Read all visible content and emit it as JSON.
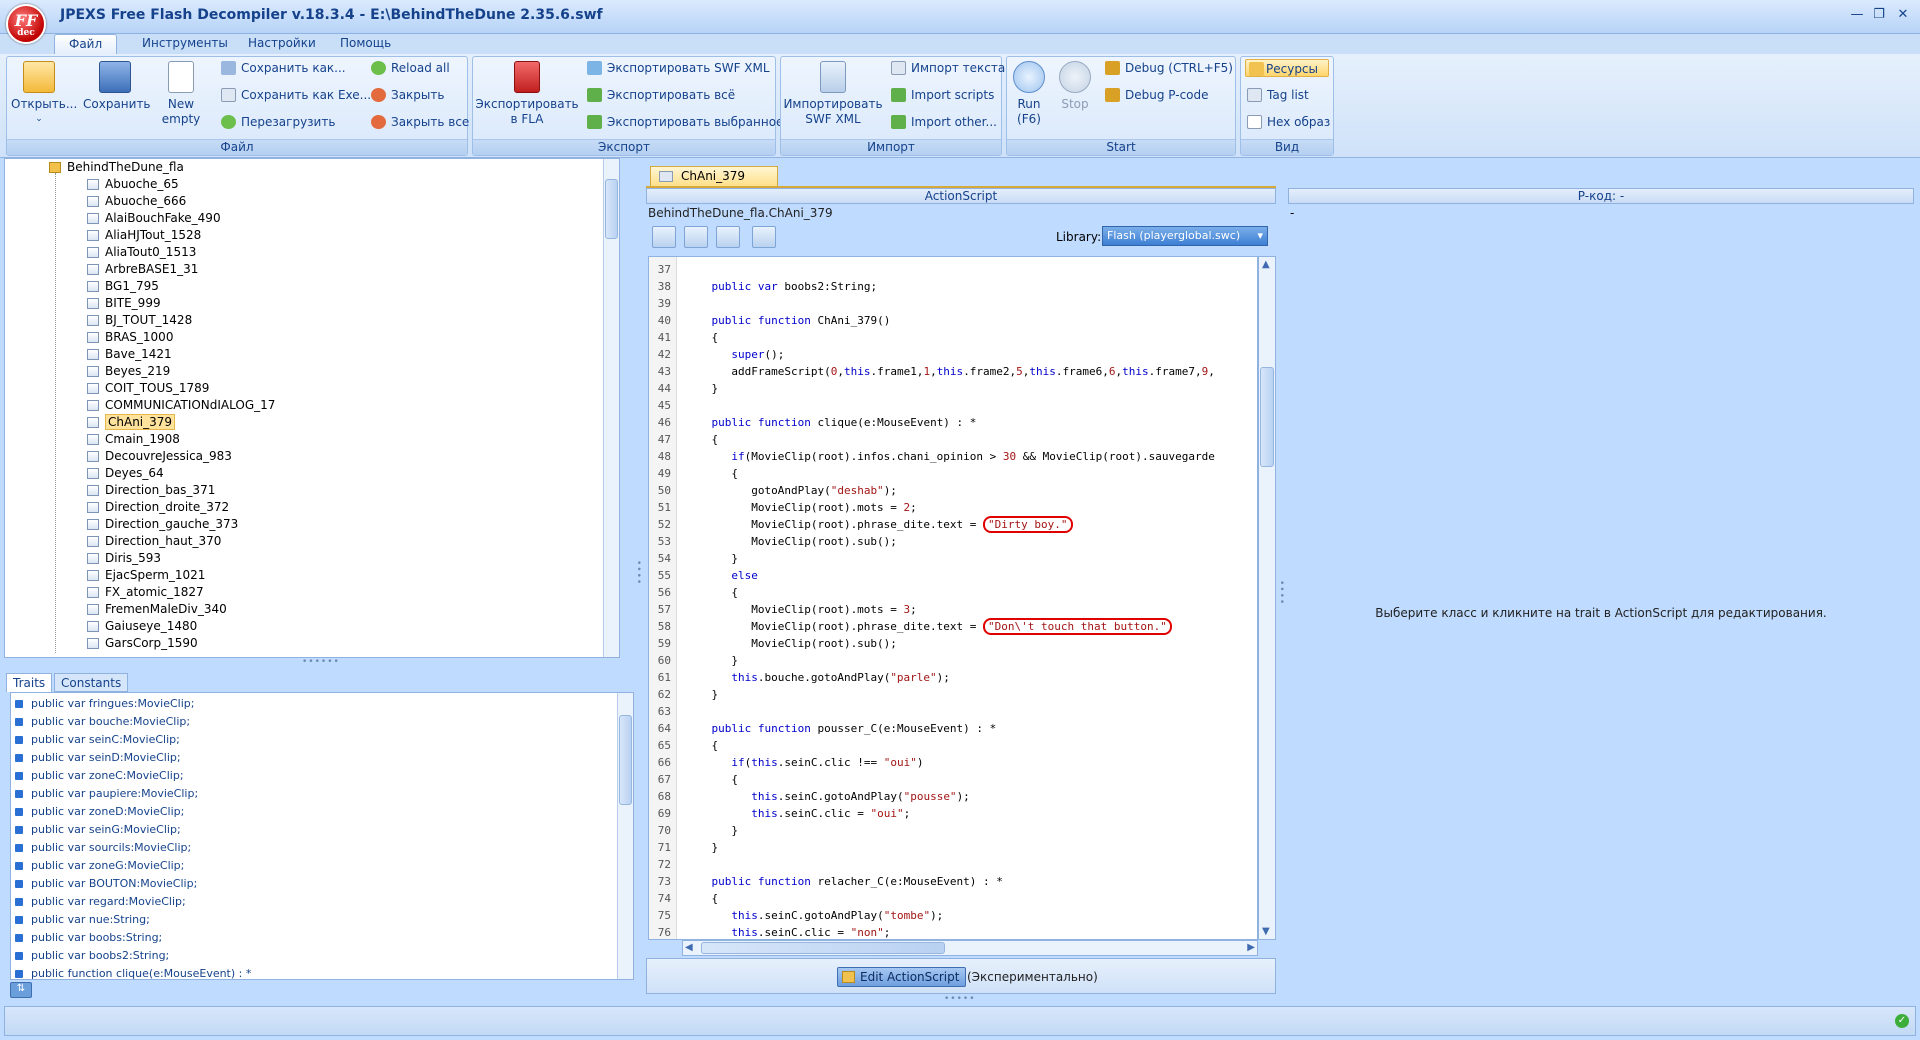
{
  "app": {
    "title": "JPEXS Free Flash Decompiler v.18.3.4 - E:\\BehindTheDune 2.35.6.swf",
    "logo_text": "FF",
    "logo_sub": "dec"
  },
  "menu_tabs": [
    "Файл",
    "Инструменты",
    "Настройки",
    "Помощь"
  ],
  "ribbon": {
    "file": {
      "title": "Файл",
      "open": "Открыть...",
      "save": "Сохранить",
      "new_empty_1": "New",
      "new_empty_2": "empty",
      "save_as": "Сохранить как...",
      "save_as_exe": "Сохранить как Exe...",
      "reload": "Перезагрузить",
      "reload_all": "Reload all",
      "close": "Закрыть",
      "close_all": "Закрыть все"
    },
    "export": {
      "title": "Экспорт",
      "export_fla_1": "Экспортировать",
      "export_fla_2": "в FLA",
      "export_swf_xml": "Экспортировать SWF XML",
      "export_all": "Экспортировать всё",
      "export_selected": "Экспортировать выбранное"
    },
    "import": {
      "title": "Импорт",
      "import_swf_xml_1": "Импортировать",
      "import_swf_xml_2": "SWF XML",
      "import_text": "Импорт текста",
      "import_scripts": "Import scripts",
      "import_other": "Import other..."
    },
    "start": {
      "title": "Start",
      "run_1": "Run",
      "run_2": "(F6)",
      "stop": "Stop",
      "debug": "Debug (CTRL+F5)",
      "debug_pcode": "Debug P-code"
    },
    "view": {
      "title": "Вид",
      "resources": "Ресурсы",
      "tag_list": "Tag list",
      "hex": "Hex образ"
    }
  },
  "tree": {
    "root": "BehindTheDune_fla",
    "items": [
      "Abuoche_65",
      "Abuoche_666",
      "AlaiBouchFake_490",
      "AliaHJTout_1528",
      "AliaTout0_1513",
      "ArbreBASE1_31",
      "BG1_795",
      "BITE_999",
      "BJ_TOUT_1428",
      "BRAS_1000",
      "Bave_1421",
      "Beyes_219",
      "COIT_TOUS_1789",
      "COMMUNICATIONdIALOG_17",
      "ChAni_379",
      "Cmain_1908",
      "DecouvreJessica_983",
      "Deyes_64",
      "Direction_bas_371",
      "Direction_droite_372",
      "Direction_gauche_373",
      "Direction_haut_370",
      "Diris_593",
      "EjacSperm_1021",
      "FX_atomic_1827",
      "FremenMaleDiv_340",
      "Gaiuseye_1480",
      "GarsCorp_1590"
    ],
    "selected": "ChAni_379"
  },
  "traits_tabs": [
    "Traits",
    "Constants"
  ],
  "traits": [
    "public var fringues:MovieClip;",
    "public var bouche:MovieClip;",
    "public var seinC:MovieClip;",
    "public var seinD:MovieClip;",
    "public var zoneC:MovieClip;",
    "public var paupiere:MovieClip;",
    "public var zoneD:MovieClip;",
    "public var seinG:MovieClip;",
    "public var sourcils:MovieClip;",
    "public var zoneG:MovieClip;",
    "public var BOUTON:MovieClip;",
    "public var regard:MovieClip;",
    "public var nue:String;",
    "public var boobs:String;",
    "public var boobs2:String;",
    "public function clique(e:MouseEvent) : *"
  ],
  "editor": {
    "tab": "ChAni_379",
    "header": "ActionScript",
    "path": "BehindTheDune_fla.ChAni_379",
    "library_label": "Library:",
    "library_value": "Flash (playerglobal.swc)",
    "edit_button": "Edit ActionScript",
    "edit_note": "(Экспериментально)"
  },
  "pcode": {
    "header": "P-код: -",
    "dash": "-",
    "message": "Выберите класс и кликните на trait в ActionScript для редактирования."
  },
  "code_lines": [
    {
      "n": "37",
      "html": ""
    },
    {
      "n": "38",
      "html": "    <span class=\"kw\">public</span> <span class=\"kw\">var</span> boobs2:String;"
    },
    {
      "n": "39",
      "html": ""
    },
    {
      "n": "40",
      "html": "    <span class=\"kw\">public</span> <span class=\"kw\">function</span> ChAni_379()"
    },
    {
      "n": "41",
      "html": "    {"
    },
    {
      "n": "42",
      "html": "       <span class=\"kw\">super</span>();"
    },
    {
      "n": "43",
      "html": "       addFrameScript(<span class=\"nm\">0</span>,<span class=\"kw\">this</span>.frame1,<span class=\"nm\">1</span>,<span class=\"kw\">this</span>.frame2,<span class=\"nm\">5</span>,<span class=\"kw\">this</span>.frame6,<span class=\"nm\">6</span>,<span class=\"kw\">this</span>.frame7,<span class=\"nm\">9</span>,"
    },
    {
      "n": "44",
      "html": "    }"
    },
    {
      "n": "45",
      "html": ""
    },
    {
      "n": "46",
      "html": "    <span class=\"kw\">public</span> <span class=\"kw\">function</span> clique(e:MouseEvent) : *"
    },
    {
      "n": "47",
      "html": "    {"
    },
    {
      "n": "48",
      "html": "       <span class=\"kw\">if</span>(MovieClip(root).infos.chani_opinion &gt; <span class=\"nm\">30</span> &amp;&amp; MovieClip(root).sauvegarde"
    },
    {
      "n": "49",
      "html": "       {"
    },
    {
      "n": "50",
      "html": "          gotoAndPlay(<span class=\"st\">\"deshab\"</span>);"
    },
    {
      "n": "51",
      "html": "          MovieClip(root).mots = <span class=\"nm\">2</span>;"
    },
    {
      "n": "52",
      "html": "          MovieClip(root).phrase_dite.text = <span class=\"st circ\">\"Dirty boy.\"</span>"
    },
    {
      "n": "53",
      "html": "          MovieClip(root).sub();"
    },
    {
      "n": "54",
      "html": "       }"
    },
    {
      "n": "55",
      "html": "       <span class=\"kw\">else</span>"
    },
    {
      "n": "56",
      "html": "       {"
    },
    {
      "n": "57",
      "html": "          MovieClip(root).mots = <span class=\"nm\">3</span>;"
    },
    {
      "n": "58",
      "html": "          MovieClip(root).phrase_dite.text = <span class=\"st circ\">\"Don\\'t touch that button.\"</span>"
    },
    {
      "n": "59",
      "html": "          MovieClip(root).sub();"
    },
    {
      "n": "60",
      "html": "       }"
    },
    {
      "n": "61",
      "html": "       <span class=\"kw\">this</span>.bouche.gotoAndPlay(<span class=\"st\">\"parle\"</span>);"
    },
    {
      "n": "62",
      "html": "    }"
    },
    {
      "n": "63",
      "html": ""
    },
    {
      "n": "64",
      "html": "    <span class=\"kw\">public</span> <span class=\"kw\">function</span> pousser_C(e:MouseEvent) : *"
    },
    {
      "n": "65",
      "html": "    {"
    },
    {
      "n": "66",
      "html": "       <span class=\"kw\">if</span>(<span class=\"kw\">this</span>.seinC.clic !== <span class=\"st\">\"oui\"</span>)"
    },
    {
      "n": "67",
      "html": "       {"
    },
    {
      "n": "68",
      "html": "          <span class=\"kw\">this</span>.seinC.gotoAndPlay(<span class=\"st\">\"pousse\"</span>);"
    },
    {
      "n": "69",
      "html": "          <span class=\"kw\">this</span>.seinC.clic = <span class=\"st\">\"oui\"</span>;"
    },
    {
      "n": "70",
      "html": "       }"
    },
    {
      "n": "71",
      "html": "    }"
    },
    {
      "n": "72",
      "html": ""
    },
    {
      "n": "73",
      "html": "    <span class=\"kw\">public</span> <span class=\"kw\">function</span> relacher_C(e:MouseEvent) : *"
    },
    {
      "n": "74",
      "html": "    {"
    },
    {
      "n": "75",
      "html": "       <span class=\"kw\">this</span>.seinC.gotoAndPlay(<span class=\"st\">\"tombe\"</span>);"
    },
    {
      "n": "76",
      "html": "       <span class=\"kw\">this</span>.seinC.clic = <span class=\"st\">\"non\"</span>;"
    }
  ],
  "colors": {
    "accent": "#15428b",
    "selection": "#ffe39c",
    "highlight_circle": "#e00000"
  }
}
